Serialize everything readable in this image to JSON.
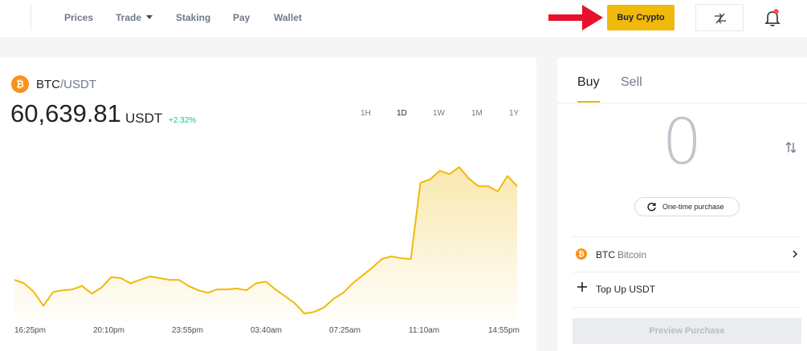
{
  "nav": {
    "items": [
      "Prices",
      "Trade",
      "Staking",
      "Pay",
      "Wallet"
    ],
    "buy_crypto_label": "Buy Crypto"
  },
  "icons": {
    "annotation": "red-arrow-icon",
    "swap": "swap-icon",
    "notification": "bell-icon",
    "coin": "bitcoin-icon",
    "refresh": "refresh-icon",
    "flip": "swap-vertical-icon",
    "chevron": "chevron-right-icon",
    "plus": "plus-icon"
  },
  "colors": {
    "accent": "#f0b90b",
    "positive": "#0ecb81",
    "notification_dot": "#f6465d",
    "annotation_arrow": "#e8112d",
    "btc": "#f7931a"
  },
  "market": {
    "base": "BTC",
    "quote": "/USDT",
    "price": "60,639.81",
    "price_unit": "USDT",
    "change": "+2.32%",
    "timeframes": [
      "1H",
      "1D",
      "1W",
      "1M",
      "1Y"
    ],
    "active_timeframe": "1D"
  },
  "chart_data": {
    "type": "area",
    "title": "",
    "xlabel": "",
    "ylabel": "",
    "x_tick_labels": [
      "16:25pm",
      "20:10pm",
      "23:55pm",
      "03:40am",
      "07:25am",
      "11:10am",
      "14:55pm"
    ],
    "series": [
      {
        "values": [
          59420,
          59380,
          59280,
          59120,
          59280,
          59300,
          59310,
          59350,
          59260,
          59330,
          59450,
          59440,
          59380,
          59420,
          59460,
          59440,
          59420,
          59420,
          59350,
          59300,
          59270,
          59310,
          59310,
          59320,
          59300,
          59380,
          59400,
          59310,
          59230,
          59150,
          59030,
          59050,
          59100,
          59200,
          59270,
          59380,
          59470,
          59560,
          59660,
          59690,
          59670,
          59660,
          60540,
          60580,
          60680,
          60640,
          60720,
          60590,
          60500,
          60500,
          60440,
          60620,
          60500
        ]
      }
    ],
    "ylim": [
      58950,
      60800
    ],
    "grid": false,
    "legend": "none",
    "line_color": "#f0b90b"
  },
  "trade": {
    "tab_buy": "Buy",
    "tab_sell": "Sell",
    "amount": "0",
    "purchase_type": "One-time purchase",
    "asset_symbol": "BTC",
    "asset_name": "Bitcoin",
    "topup_label": "Top Up USDT",
    "preview_label": "Preview Purchase"
  }
}
